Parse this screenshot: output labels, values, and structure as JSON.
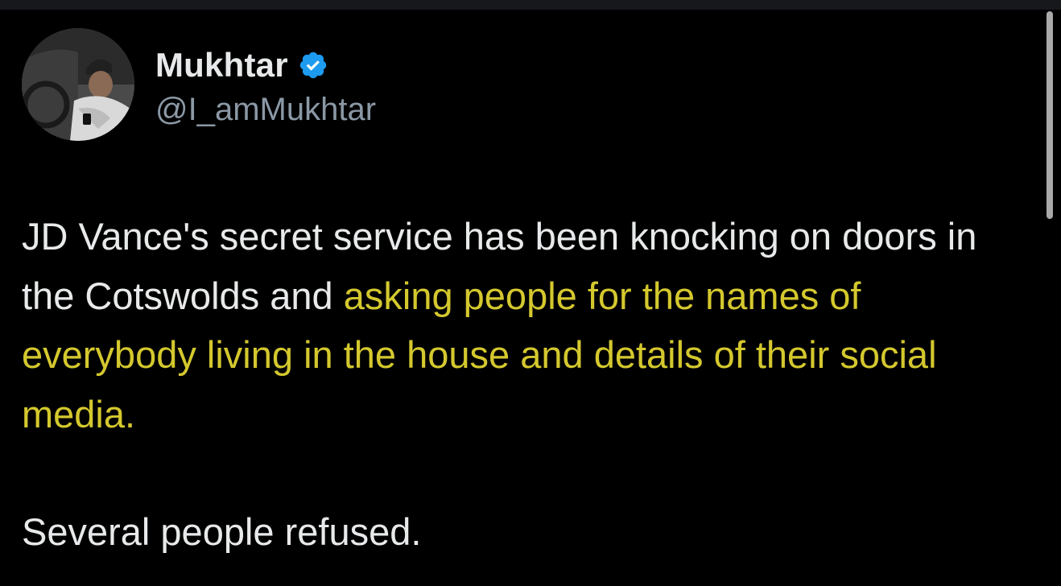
{
  "tweet": {
    "author": {
      "display_name": "Mukhtar",
      "handle": "@I_amMukhtar",
      "verified": true,
      "avatar_icon": "profile-photo"
    },
    "text_part1": "JD Vance's secret service has been knocking on doors in the Cotswolds and ",
    "text_highlight": "asking people for the names of everybody living in the house and details of their social media.",
    "text_part2": "Several people refused."
  },
  "colors": {
    "background": "#000000",
    "text": "#e7e9ea",
    "handle": "#8b98a5",
    "highlight": "#d4c82e",
    "verified_badge": "#1d9bf0"
  }
}
